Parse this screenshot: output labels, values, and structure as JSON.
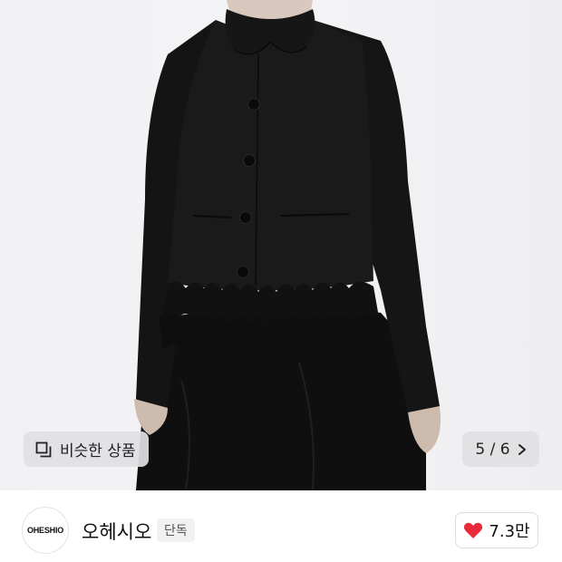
{
  "hero": {
    "similar_button_label": "비슷한 상품",
    "image_counter": "5 / 6"
  },
  "seller": {
    "logo_text": "OHESHIO",
    "brand_name": "오헤시오",
    "badge_label": "단독"
  },
  "like": {
    "count": "7.3만"
  },
  "colors": {
    "heart": "#ea2a3a",
    "background_photo": "#f3f3f5",
    "garment": "#121212"
  },
  "icons": {
    "similar": "copy-icon",
    "next": "chevron-right-icon",
    "like": "heart-icon"
  }
}
